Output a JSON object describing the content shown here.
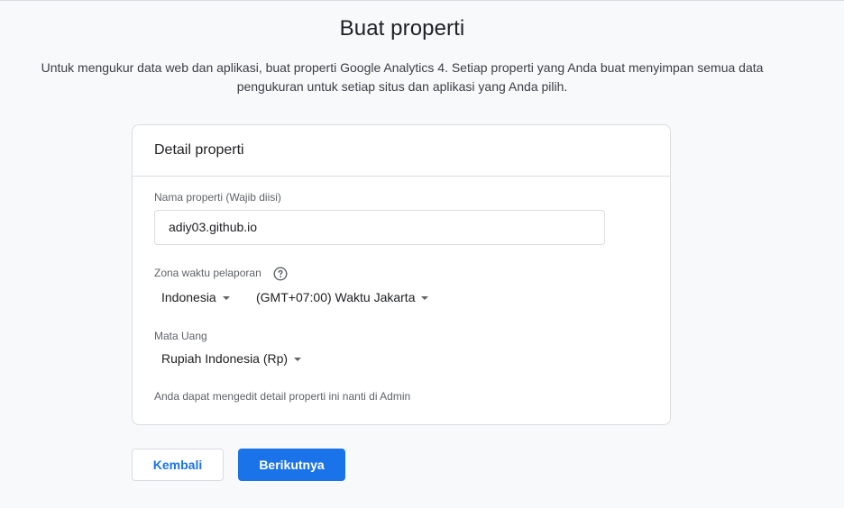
{
  "page": {
    "title": "Buat properti",
    "description": "Untuk mengukur data web dan aplikasi, buat properti Google Analytics 4. Setiap properti yang Anda buat menyimpan semua data pengukuran untuk setiap situs dan aplikasi yang Anda pilih."
  },
  "card": {
    "header": "Detail properti",
    "property_name": {
      "label": "Nama properti (Wajib diisi)",
      "value": "adiy03.github.io"
    },
    "timezone": {
      "label": "Zona waktu pelaporan",
      "help_icon": "help-circle-icon",
      "country": "Indonesia",
      "zone": "(GMT+07:00) Waktu Jakarta"
    },
    "currency": {
      "label": "Mata Uang",
      "value": "Rupiah Indonesia (Rp)"
    },
    "hint": "Anda dapat mengedit detail properti ini nanti di Admin"
  },
  "buttons": {
    "back": "Kembali",
    "next": "Berikutnya"
  },
  "colors": {
    "primary": "#1a73e8",
    "background": "#f8f9fa",
    "border": "#dadce0"
  }
}
